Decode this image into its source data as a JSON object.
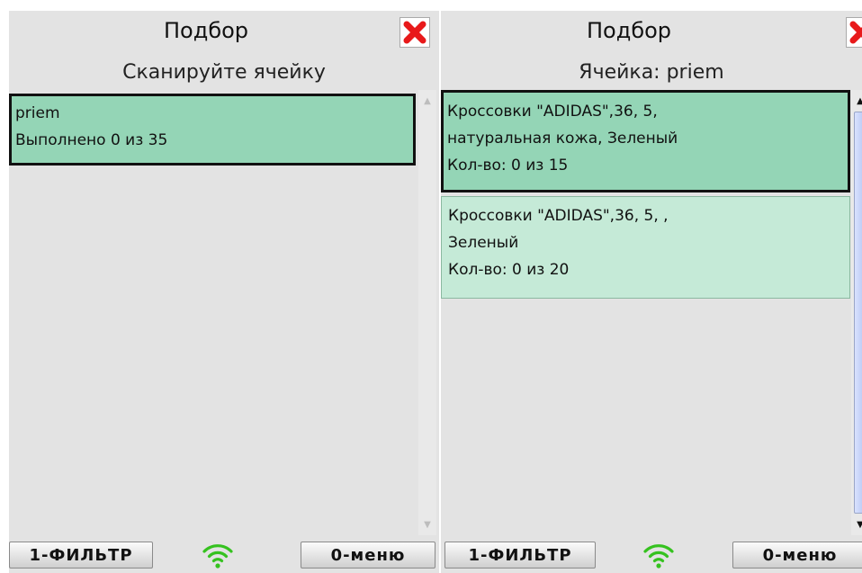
{
  "left_screen": {
    "title": "Подбор",
    "subtitle": "Сканируйте ячейку",
    "items": [
      {
        "line1": "priem",
        "line2": "Выполнено 0 из 35"
      }
    ],
    "filter_button": "1-ФИЛЬТР",
    "menu_button": "0-меню"
  },
  "right_screen": {
    "title": "Подбор",
    "subtitle": "Ячейка: priem",
    "items": [
      {
        "line1": "Кроссовки \"ADIDAS\",36, 5,",
        "line2": "натуральная кожа, Зеленый",
        "line3": "Кол-во: 0 из 15"
      },
      {
        "line1": "Кроссовки \"ADIDAS\",36, 5, ,",
        "line2": "Зеленый",
        "line3": "Кол-во: 0 из 20"
      }
    ],
    "filter_button": "1-ФИЛЬТР",
    "menu_button": "0-меню"
  },
  "icons": {
    "close": "close-icon",
    "wifi": "wifi-icon"
  },
  "colors": {
    "selected_item": "#94d5b6",
    "normal_item": "#c5ead7",
    "close_red": "#e8191a",
    "wifi_green": "#35c21f"
  }
}
